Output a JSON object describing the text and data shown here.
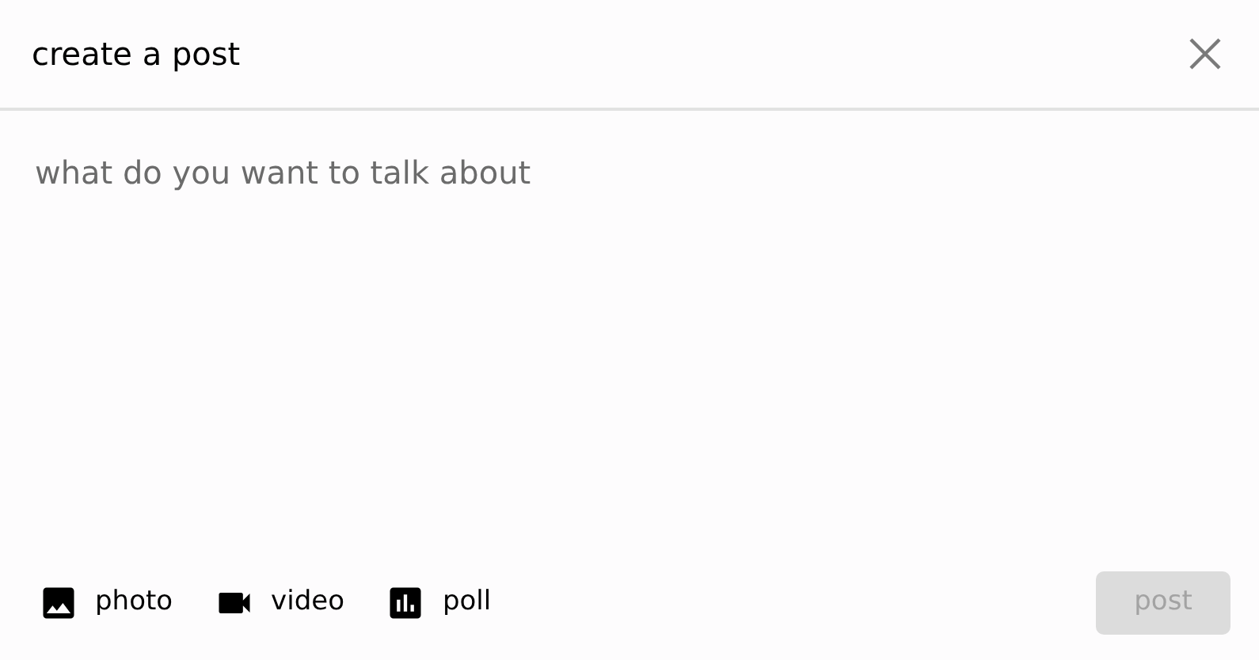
{
  "dialog": {
    "title": "create a post"
  },
  "composer": {
    "placeholder": "what do you want to talk about"
  },
  "attachments": [
    {
      "kind": "photo",
      "label": "photo"
    },
    {
      "kind": "video",
      "label": "video"
    },
    {
      "kind": "poll",
      "label": "poll"
    }
  ],
  "submit": {
    "label": "post",
    "disabled": true
  }
}
